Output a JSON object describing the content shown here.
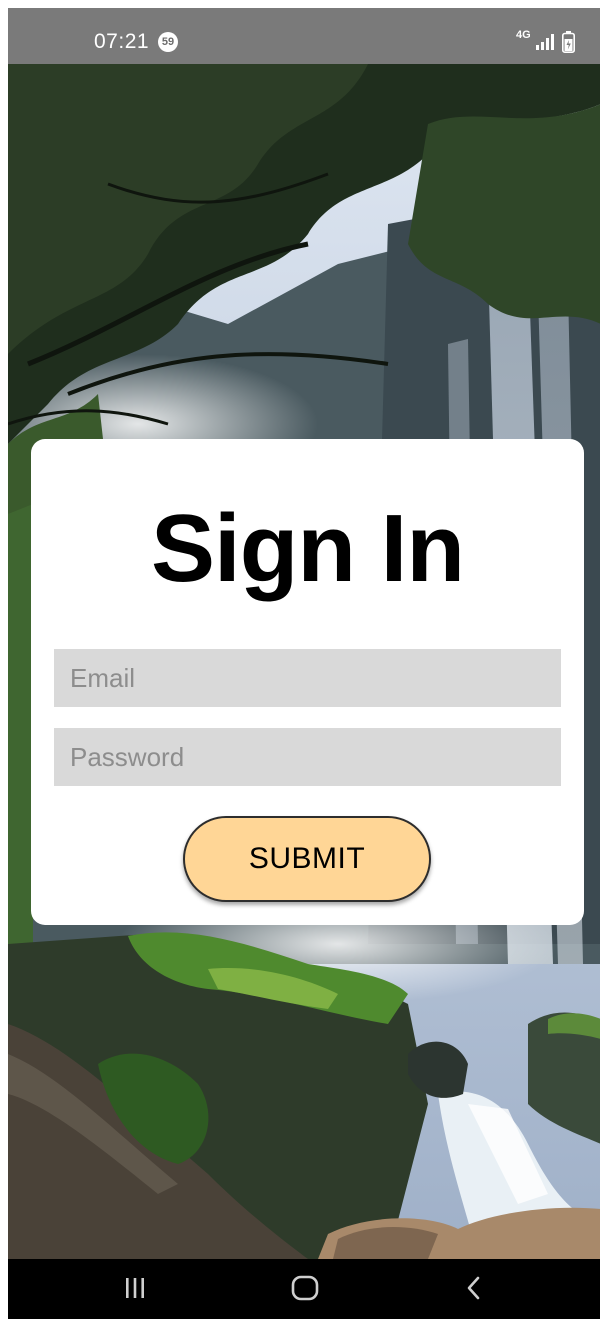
{
  "status_bar": {
    "time": "07:21",
    "notification_count": "59",
    "network_type": "4G",
    "icons": [
      "signal-icon",
      "battery-icon"
    ]
  },
  "background": {
    "description_icon": "waterfall-forest-photo"
  },
  "signin": {
    "title": "Sign In",
    "email": {
      "value": "",
      "placeholder": "Email"
    },
    "password": {
      "value": "",
      "placeholder": "Password"
    },
    "submit_label": "SUBMIT"
  },
  "colors": {
    "card_bg": "#ffffff",
    "field_bg": "#d9d9d9",
    "button_bg": "#ffd696",
    "statusbar_bg": "#7a7a7a",
    "navbar_bg": "#000000"
  },
  "nav_bar": {
    "icons": [
      "recents-icon",
      "home-icon",
      "back-icon"
    ]
  }
}
